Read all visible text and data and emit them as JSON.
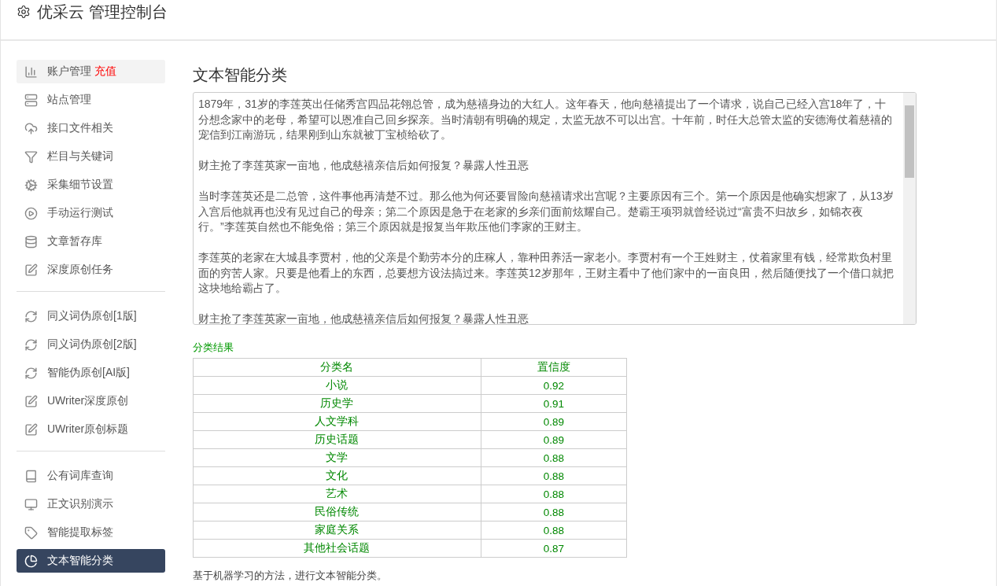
{
  "header": {
    "title": "优采云 管理控制台"
  },
  "sidebar": {
    "groups": [
      {
        "items": [
          {
            "label": "账户管理",
            "badge": "充值",
            "selected": false,
            "highlighted": true
          },
          {
            "label": "站点管理",
            "selected": false,
            "highlighted": false
          },
          {
            "label": "接口文件相关",
            "selected": false,
            "highlighted": false
          },
          {
            "label": "栏目与关键词",
            "selected": false,
            "highlighted": false
          },
          {
            "label": "采集细节设置",
            "selected": false,
            "highlighted": false
          },
          {
            "label": "手动运行测试",
            "selected": false,
            "highlighted": false
          },
          {
            "label": "文章暂存库",
            "selected": false,
            "highlighted": false
          },
          {
            "label": "深度原创任务",
            "selected": false,
            "highlighted": false
          }
        ]
      },
      {
        "items": [
          {
            "label": "同义词伪原创[1版]",
            "selected": false,
            "highlighted": false
          },
          {
            "label": "同义词伪原创[2版]",
            "selected": false,
            "highlighted": false
          },
          {
            "label": "智能伪原创[AI版]",
            "selected": false,
            "highlighted": false
          },
          {
            "label": "UWriter深度原创",
            "selected": false,
            "highlighted": false
          },
          {
            "label": "UWriter原创标题",
            "selected": false,
            "highlighted": false
          }
        ]
      },
      {
        "items": [
          {
            "label": "公有词库查询",
            "selected": false,
            "highlighted": false
          },
          {
            "label": "正文识别演示",
            "selected": false,
            "highlighted": false
          },
          {
            "label": "智能提取标签",
            "selected": false,
            "highlighted": false
          },
          {
            "label": "文本智能分类",
            "selected": true,
            "highlighted": false
          }
        ]
      }
    ]
  },
  "main": {
    "title": "文本智能分类",
    "textarea": {
      "paragraphs": [
        "1879年，31岁的李莲英出任储秀宫四品花翎总管，成为慈禧身边的大红人。这年春天，他向慈禧提出了一个请求，说自己已经入宫18年了，十分想念家中的老母，希望可以恩准自己回乡探亲。当时清朝有明确的规定，太监无故不可以出宫。十年前，时任大总管太监的安德海仗着慈禧的宠信到江南游玩，结果刚到山东就被丁宝桢给砍了。",
        "财主抢了李莲英家一亩地，他成慈禧亲信后如何报复？暴露人性丑恶",
        "当时李莲英还是二总管，这件事他再清楚不过。那么他为何还要冒险向慈禧请求出宫呢？主要原因有三个。第一个原因是他确实想家了，从13岁入宫后他就再也没有见过自己的母亲；第二个原因是急于在老家的乡亲们面前炫耀自己。楚霸王项羽就曾经说过“富贵不归故乡，如锦衣夜行。”李莲英自然也不能免俗；第三个原因就是报复当年欺压他们李家的王财主。",
        "李莲英的老家在大城县李贾村，他的父亲是个勤劳本分的庄稼人，靠种田养活一家老小。李贾村有一个王姓财主，仗着家里有钱，经常欺负村里面的穷苦人家。只要是他看上的东西，总要想方设法搞过来。李莲英12岁那年，王财主看中了他们家中的一亩良田，然后随便找了一个借口就把这块地给霸占了。",
        "财主抢了李莲英家一亩地，他成慈禧亲信后如何报复？暴露人性丑恶"
      ]
    },
    "result_label": "分类结果",
    "table": {
      "columns": [
        "分类名",
        "置信度"
      ],
      "rows": [
        [
          "小说",
          "0.92"
        ],
        [
          "历史学",
          "0.91"
        ],
        [
          "人文学科",
          "0.89"
        ],
        [
          "历史话题",
          "0.89"
        ],
        [
          "文学",
          "0.88"
        ],
        [
          "文化",
          "0.88"
        ],
        [
          "艺术",
          "0.88"
        ],
        [
          "民俗传统",
          "0.88"
        ],
        [
          "家庭关系",
          "0.88"
        ],
        [
          "其他社会话题",
          "0.87"
        ]
      ]
    },
    "note": "基于机器学习的方法，进行文本智能分类。"
  }
}
